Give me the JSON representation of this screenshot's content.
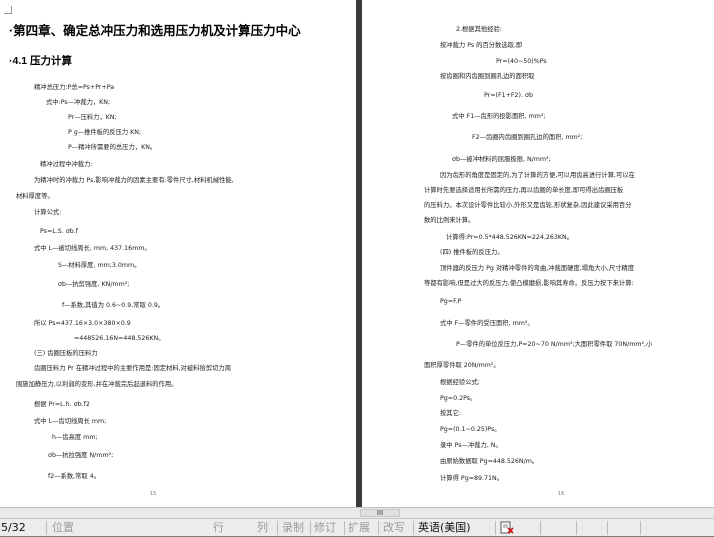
{
  "left_page": {
    "chapter_title": "·第四章、确定总冲压力和选用压力机及计算压力中心",
    "section_title": "·4.1 压力计算",
    "lines": [
      "精冲总压力:P总=Ps+Pr+Pa",
      "式中:Ps—冲裁力，KN;",
      "Pr—压料力，KN;",
      "P g—推件板的反压力 KN;",
      "P—精冲所需要的总压力，KN。",
      "精冲过程中冲裁力:",
      "为精冲时的冲裁力 Ps,影响冲裁力的因素主要有:零件尺寸,材料机械性能,",
      "材料厚度等。",
      "计算公式:",
      "Ps=L.S. σb.f",
      "式中 L—被切线周长, mm, 437.16mm。",
      "S—材料厚度, mm;3.0mm。",
      "σb—抗剪强度, KN/mm²;",
      "f—系数,其值为 0.6~0.9,常取 0.9。",
      "所以 Ps=437.16×3.0×380×0.9",
      "=448526.16N=448.526KN。",
      "(三) 齿圈压板的压料力",
      "齿圈压料力 Pr 在精冲过程中的主要作用是:固定材料,对被料拾剪切力周",
      "围施加静压力,以利弱的变形,并在冲裁完后起退料的作用。",
      "根据 Pr=L.h. σb.f2",
      "式中 L—齿切线周长 mm;",
      "h—齿高度 mm;",
      "σb—抗拉强度 N/mm²;",
      "f2—系数,常取 4。"
    ],
    "page_number": "15"
  },
  "right_page": {
    "lines": [
      "2.根据其他经验:",
      "按冲裁力 Ps 的百分数选取,即",
      "Pr=(40~50)%Ps",
      "按齿圈和内齿圈到圈孔边的面积取",
      "Pr=(F1+F2). σb",
      "式中 F1—齿形的投影面积, mm²;",
      "F2—齿圈内齿圈到圈孔边的面积, mm²;",
      "σb—被冲材料的屈服极限, N/mm²;",
      "因为齿形的角度是固定的,为了计算的方便,可以用齿高进行计算,可以在",
      "计算时先要选择适用长所需的压力,再以齿圈的单长度,即可得出齿圈压板",
      "的压料力。本次设计零件比较小,外形又是齿轮,形状复杂,因此建议采用百分",
      "数的比例来计算。",
      "计算得:Pr=0.5*448.526KN=224.263KN。",
      "(四) 推件板的反压力。",
      "顶件器的反压力 Pg 对精冲零件的弯曲,冲裁面硬度,塌角大小,尺寸精度",
      "等都有影响,但是过大的反压力,使凸模磨损,影响其寿命。反压力按下来计算:",
      "Pg=F.P",
      "式中 F—零件的受压面积, mm²。",
      "P—零件的单位反压力,P=20~70 N/mm²;大面积零件取 70N/mm²,小",
      "面积厚零件取 20N/mm²。",
      "根据经验公式:",
      "Pg=0.2Ps。",
      "按其它:",
      "Pg=(0.1~0.25)Ps。",
      "录中 Ps—冲裁力, N。",
      "由原始数据取 Pg=448.526N/m。",
      "计算得 Pg=89.71N。"
    ],
    "page_number": "16"
  },
  "scrollbar": {
    "thumb_label": "III"
  },
  "status_bar": {
    "page_indicator": "5/32",
    "position": "位置",
    "row": "行",
    "column": "列",
    "record": "录制",
    "revision": "修订",
    "extend": "扩展",
    "overwrite": "改写",
    "language": "英语(美国)",
    "language_icon": "spellcheck-book-icon"
  }
}
